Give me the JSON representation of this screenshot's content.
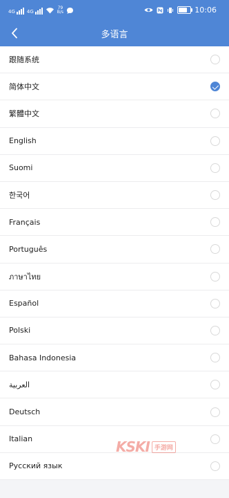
{
  "status_bar": {
    "sim1_label": "4G",
    "sim2_label": "4G",
    "speed_value": "79",
    "speed_unit": "B/s",
    "time": "10:06",
    "battery_level": 0.85
  },
  "nav": {
    "title": "多语言"
  },
  "languages": [
    {
      "label": "跟随系统",
      "selected": false
    },
    {
      "label": "简体中文",
      "selected": true
    },
    {
      "label": "繁體中文",
      "selected": false
    },
    {
      "label": "English",
      "selected": false
    },
    {
      "label": "Suomi",
      "selected": false
    },
    {
      "label": "한국어",
      "selected": false
    },
    {
      "label": "Français",
      "selected": false
    },
    {
      "label": "Português",
      "selected": false
    },
    {
      "label": "ภาษาไทย",
      "selected": false
    },
    {
      "label": "Español",
      "selected": false
    },
    {
      "label": "Polski",
      "selected": false
    },
    {
      "label": "Bahasa Indonesia",
      "selected": false
    },
    {
      "label": "العربية",
      "selected": false
    },
    {
      "label": "Deutsch",
      "selected": false
    },
    {
      "label": "Italian",
      "selected": false
    },
    {
      "label": "Русский язык",
      "selected": false
    }
  ],
  "watermark": {
    "brand": "KSKI",
    "tag": "手游网"
  },
  "colors": {
    "accent": "#4f86d6",
    "divider": "#ececee",
    "unchecked_border": "#d9d9d9"
  }
}
